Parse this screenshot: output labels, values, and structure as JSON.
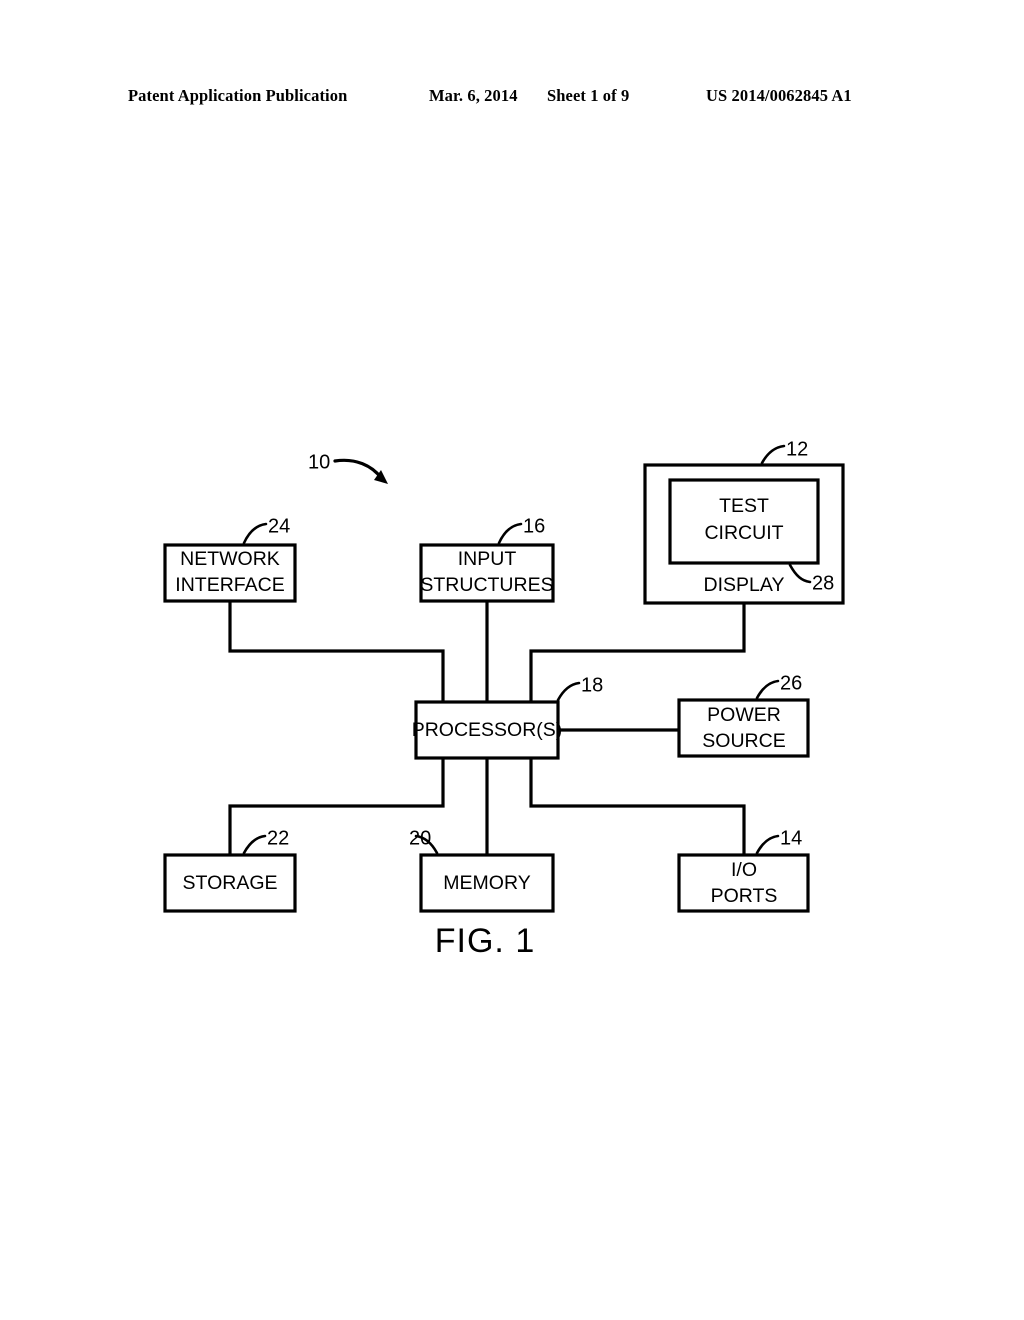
{
  "header": {
    "publication": "Patent Application Publication",
    "date": "Mar. 6, 2014",
    "sheet": "Sheet 1 of 9",
    "patent_number": "US 2014/0062845 A1"
  },
  "figure": {
    "caption": "FIG. 1",
    "system_ref": "10",
    "blocks": [
      {
        "id": "network-interface",
        "label_line1": "NETWORK",
        "label_line2": "INTERFACE",
        "ref": "24"
      },
      {
        "id": "input-structures",
        "label_line1": "INPUT",
        "label_line2": "STRUCTURES",
        "ref": "16"
      },
      {
        "id": "display",
        "label_line1": "DISPLAY",
        "label_line2": "",
        "ref": "12"
      },
      {
        "id": "test-circuit",
        "label_line1": "TEST",
        "label_line2": "CIRCUIT",
        "ref": "28"
      },
      {
        "id": "processors",
        "label_line1": "PROCESSOR(S)",
        "label_line2": "",
        "ref": "18"
      },
      {
        "id": "power-source",
        "label_line1": "POWER",
        "label_line2": "SOURCE",
        "ref": "26"
      },
      {
        "id": "storage",
        "label_line1": "STORAGE",
        "label_line2": "",
        "ref": "22"
      },
      {
        "id": "memory",
        "label_line1": "MEMORY",
        "label_line2": "",
        "ref": "20"
      },
      {
        "id": "io-ports",
        "label_line1": "I/O",
        "label_line2": "PORTS",
        "ref": "14"
      }
    ]
  },
  "colors": {
    "ink": "#000000",
    "paper": "#ffffff"
  }
}
